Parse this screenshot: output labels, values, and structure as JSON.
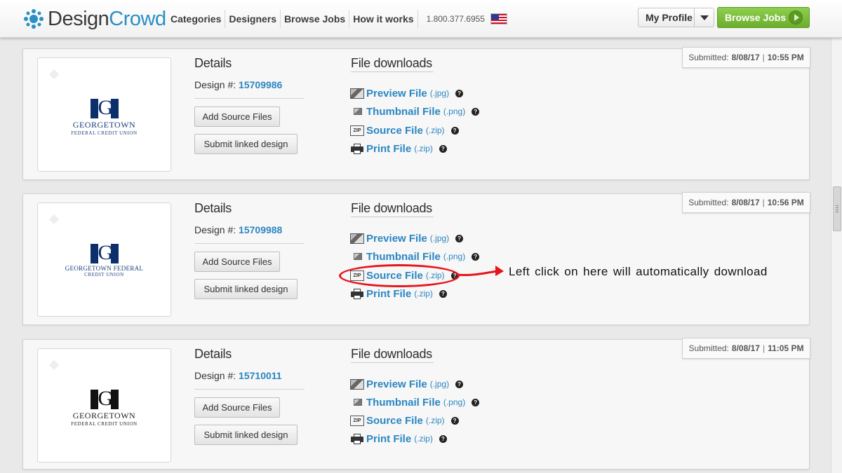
{
  "header": {
    "logo_design": "Design",
    "logo_crowd": "Crowd",
    "nav": [
      "Categories",
      "Designers",
      "Browse Jobs",
      "How it works"
    ],
    "phone": "1.800.377.6955",
    "profile_label": "My Profile",
    "browse_jobs_label": "Browse Jobs"
  },
  "labels": {
    "details": "Details",
    "file_downloads": "File downloads",
    "design_prefix": "Design #:",
    "add_source": "Add Source Files",
    "submit_linked": "Submit linked design",
    "submitted_prefix": "Submitted:",
    "help": "?"
  },
  "files": [
    {
      "name": "Preview File",
      "ext": "(.jpg)",
      "icon": "image-icon"
    },
    {
      "name": "Thumbnail File",
      "ext": "(.png)",
      "icon": "thumbnail-icon"
    },
    {
      "name": "Source File",
      "ext": "(.zip)",
      "icon": "zip-icon"
    },
    {
      "name": "Print File",
      "ext": "(.zip)",
      "icon": "printer-icon"
    }
  ],
  "designs": [
    {
      "design_number": "15709986",
      "submitted_date": "8/08/17",
      "submitted_time": "10:55 PM",
      "brand_name": "GEORGETOWN",
      "brand_sub": "FEDERAL CREDIT UNION",
      "logo_color": "blue"
    },
    {
      "design_number": "15709988",
      "submitted_date": "8/08/17",
      "submitted_time": "10:56 PM",
      "brand_name": "GEORGETOWN FEDERAL",
      "brand_sub": "CREDIT UNION",
      "logo_color": "blue"
    },
    {
      "design_number": "15710011",
      "submitted_date": "8/08/17",
      "submitted_time": "11:05 PM",
      "brand_name": "GEORGETOWN",
      "brand_sub": "FEDERAL CREDIT UNION",
      "logo_color": "black"
    }
  ],
  "annotation": {
    "text": "Left click on here will automatically download",
    "color": "#e8141c"
  },
  "colors": {
    "link": "#2a86c2",
    "browse_green": "#7cbd3d"
  }
}
